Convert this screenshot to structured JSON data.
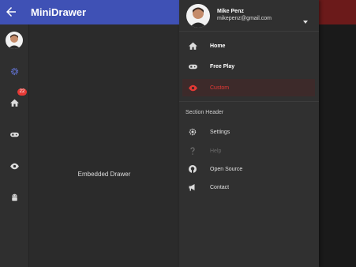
{
  "app": {
    "title": "MiniDrawer"
  },
  "content": {
    "text": "Embedded Drawer"
  },
  "mini_drawer": {
    "badge": "22"
  },
  "account": {
    "name": "Mike Penz",
    "email": "mikepenz@gmail.com"
  },
  "drawer": {
    "items": [
      {
        "label": "Home",
        "icon": "home-icon"
      },
      {
        "label": "Free Play",
        "icon": "gamepad-icon"
      },
      {
        "label": "Custom",
        "icon": "eye-icon",
        "selected": true
      }
    ],
    "section_header": "Section Header",
    "secondary_items": [
      {
        "label": "Settings",
        "icon": "gear-icon"
      },
      {
        "label": "Help",
        "icon": "help-icon",
        "disabled": true
      },
      {
        "label": "Open Source",
        "icon": "github-icon"
      },
      {
        "label": "Contact",
        "icon": "megaphone-icon"
      }
    ]
  },
  "colors": {
    "primary": "#3f51b5",
    "accent": "#e53935",
    "drawer_bg": "#303030",
    "background": "#2b2b2b"
  }
}
